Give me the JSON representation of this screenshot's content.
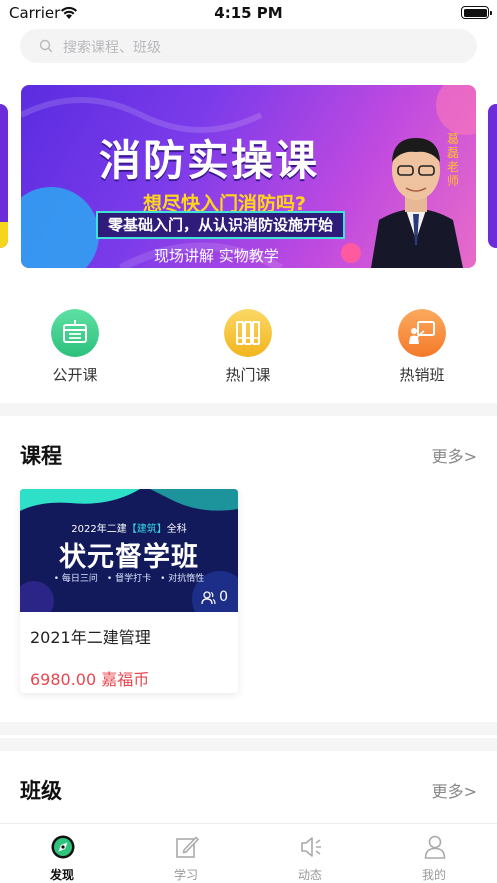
{
  "status": {
    "carrier": "Carrier",
    "time": "4:15 PM"
  },
  "search": {
    "placeholder": "搜索课程、班级"
  },
  "banner": {
    "title": "消防实操课",
    "question": "想尽快入门消防吗?",
    "tagline": "零基础入门，从认识消防设施开始",
    "subtitle": "现场讲解 实物教学",
    "teacher": "葛磊老师"
  },
  "quick_nav": [
    {
      "label": "公开课",
      "icon": "book-board-icon",
      "color": "#3dd08c"
    },
    {
      "label": "热门课",
      "icon": "binders-icon",
      "color": "#f6c437"
    },
    {
      "label": "热销班",
      "icon": "teacher-board-icon",
      "color": "#f8893a"
    }
  ],
  "courses_section": {
    "title": "课程",
    "more": "更多>"
  },
  "course_card": {
    "thumb_sub_prefix": "2022年二建",
    "thumb_sub_highlight": "【建筑】",
    "thumb_sub_suffix": "全科",
    "thumb_main": "状元督学班",
    "thumb_bullets": "• 每日三问　• 督学打卡　• 对抗惰性",
    "count": "0",
    "name": "2021年二建管理",
    "price": "6980.00 嘉福币"
  },
  "class_section": {
    "title": "班级",
    "more": "更多>"
  },
  "tabs": [
    {
      "label": "发现",
      "icon": "compass-icon",
      "active": true
    },
    {
      "label": "学习",
      "icon": "edit-icon",
      "active": false
    },
    {
      "label": "动态",
      "icon": "speaker-icon",
      "active": false
    },
    {
      "label": "我的",
      "icon": "user-icon",
      "active": false
    }
  ],
  "colors": {
    "accent_green": "#3dd08c",
    "price_red": "#e8474d",
    "banner_purple": "#6a2dd8"
  }
}
